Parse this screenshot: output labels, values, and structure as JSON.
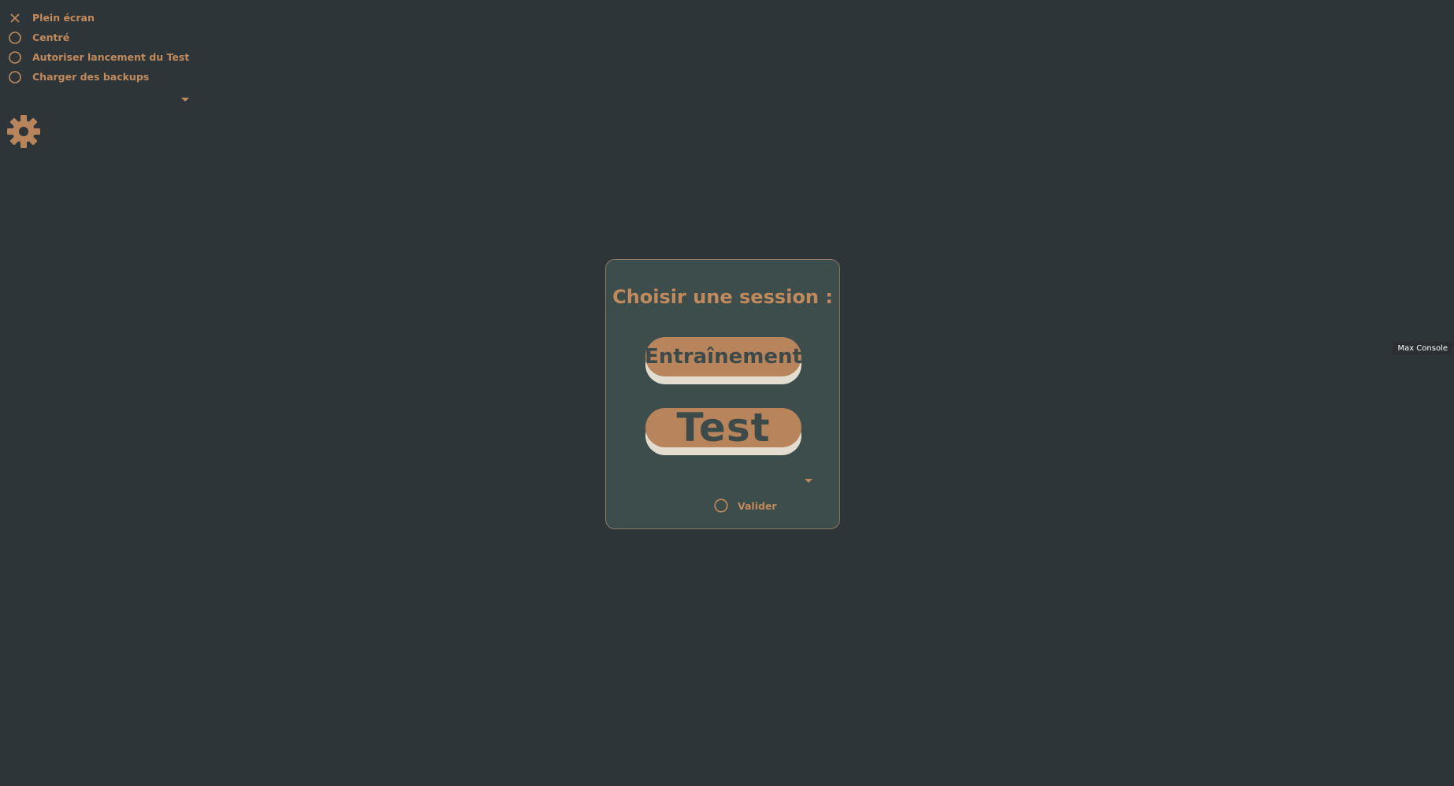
{
  "settings": {
    "toggles": [
      {
        "label": "Plein écran",
        "state": "x",
        "icon": "close-icon"
      },
      {
        "label": "Centré",
        "state": "off",
        "icon": "circle-icon"
      },
      {
        "label": "Autoriser lancement du Test",
        "state": "off",
        "icon": "circle-icon"
      },
      {
        "label": "Charger des backups",
        "state": "off",
        "icon": "circle-icon"
      }
    ],
    "gear_icon": "gear-icon"
  },
  "modal": {
    "title": "Choisir une session :",
    "training_label": "Entraînement",
    "test_label": "Test",
    "validate_label": "Valider"
  },
  "console": {
    "label": "Max Console"
  },
  "colors": {
    "background": "#2e3538",
    "accent": "#c08a5c",
    "modal_bg": "#3d4d4c",
    "button_face": "#b8845b",
    "button_shadow": "#e3ddd0",
    "button_text": "#3d4a4a"
  }
}
